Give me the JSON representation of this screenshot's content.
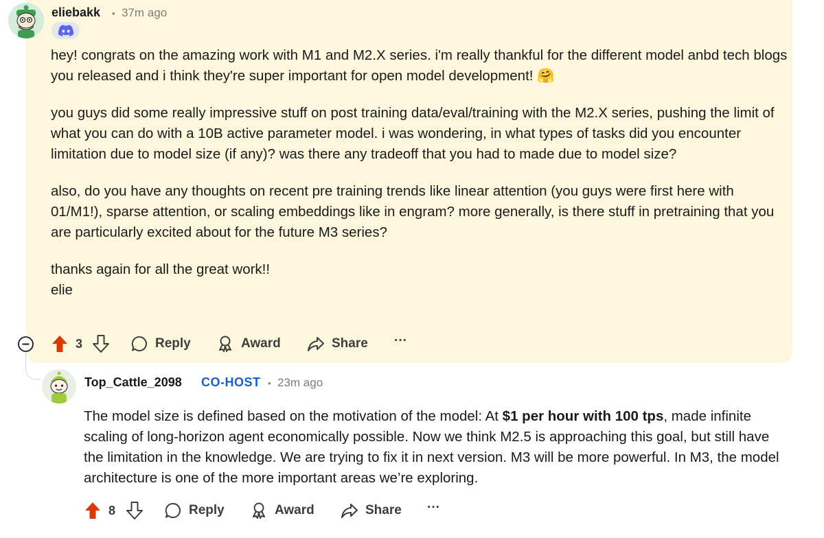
{
  "comments": [
    {
      "username": "eliebakk",
      "time": "37m ago",
      "flair_icon": "discord-icon",
      "paragraphs": [
        "hey! congrats on the amazing work with M1 and M2.X series. i'm really thankful for the different model anbd tech blogs you released and i think they're super important for open model development! 🤗",
        "you guys did some really impressive stuff on post training data/eval/training with the M2.X series, pushing the limit of what you can do with a 10B active parameter model. i was wondering, in what types of tasks did you encounter limitation due to model size (if any)? was there any tradeoff that you had to made due to model size?",
        "also, do you have any thoughts on recent pre training trends like linear attention (you guys were first here with 01/M1!), sparse attention, or scaling embeddings like in engram? more generally, is there stuff in pretraining that you are particularly excited about for the future M3 series?"
      ],
      "closing_lines": [
        "thanks again for all the great work!!",
        "elie"
      ],
      "votes": "3",
      "background": "#fcf7dd"
    },
    {
      "username": "Top_Cattle_2098",
      "flair": "CO-HOST",
      "time": "23m ago",
      "text_pre": "The model size is defined based on the motivation of the model: At ",
      "text_bold": "$1 per hour with 100 tps",
      "text_post": ", made infinite scaling of long-horizon agent economically possible. Now we think M2.5 is approaching this goal, but still have the limitation in the knowledge. We are trying to fix it in next version. M3 will be more powerful. In M3, the model architecture is one of the more important areas we’re exploring.",
      "votes": "8"
    }
  ],
  "actions": {
    "reply": "Reply",
    "award": "Award",
    "share": "Share",
    "more": "···"
  },
  "colors": {
    "upvote": "#d93a00",
    "cohost": "#1a5dc8",
    "muted": "#7c7c7c"
  }
}
